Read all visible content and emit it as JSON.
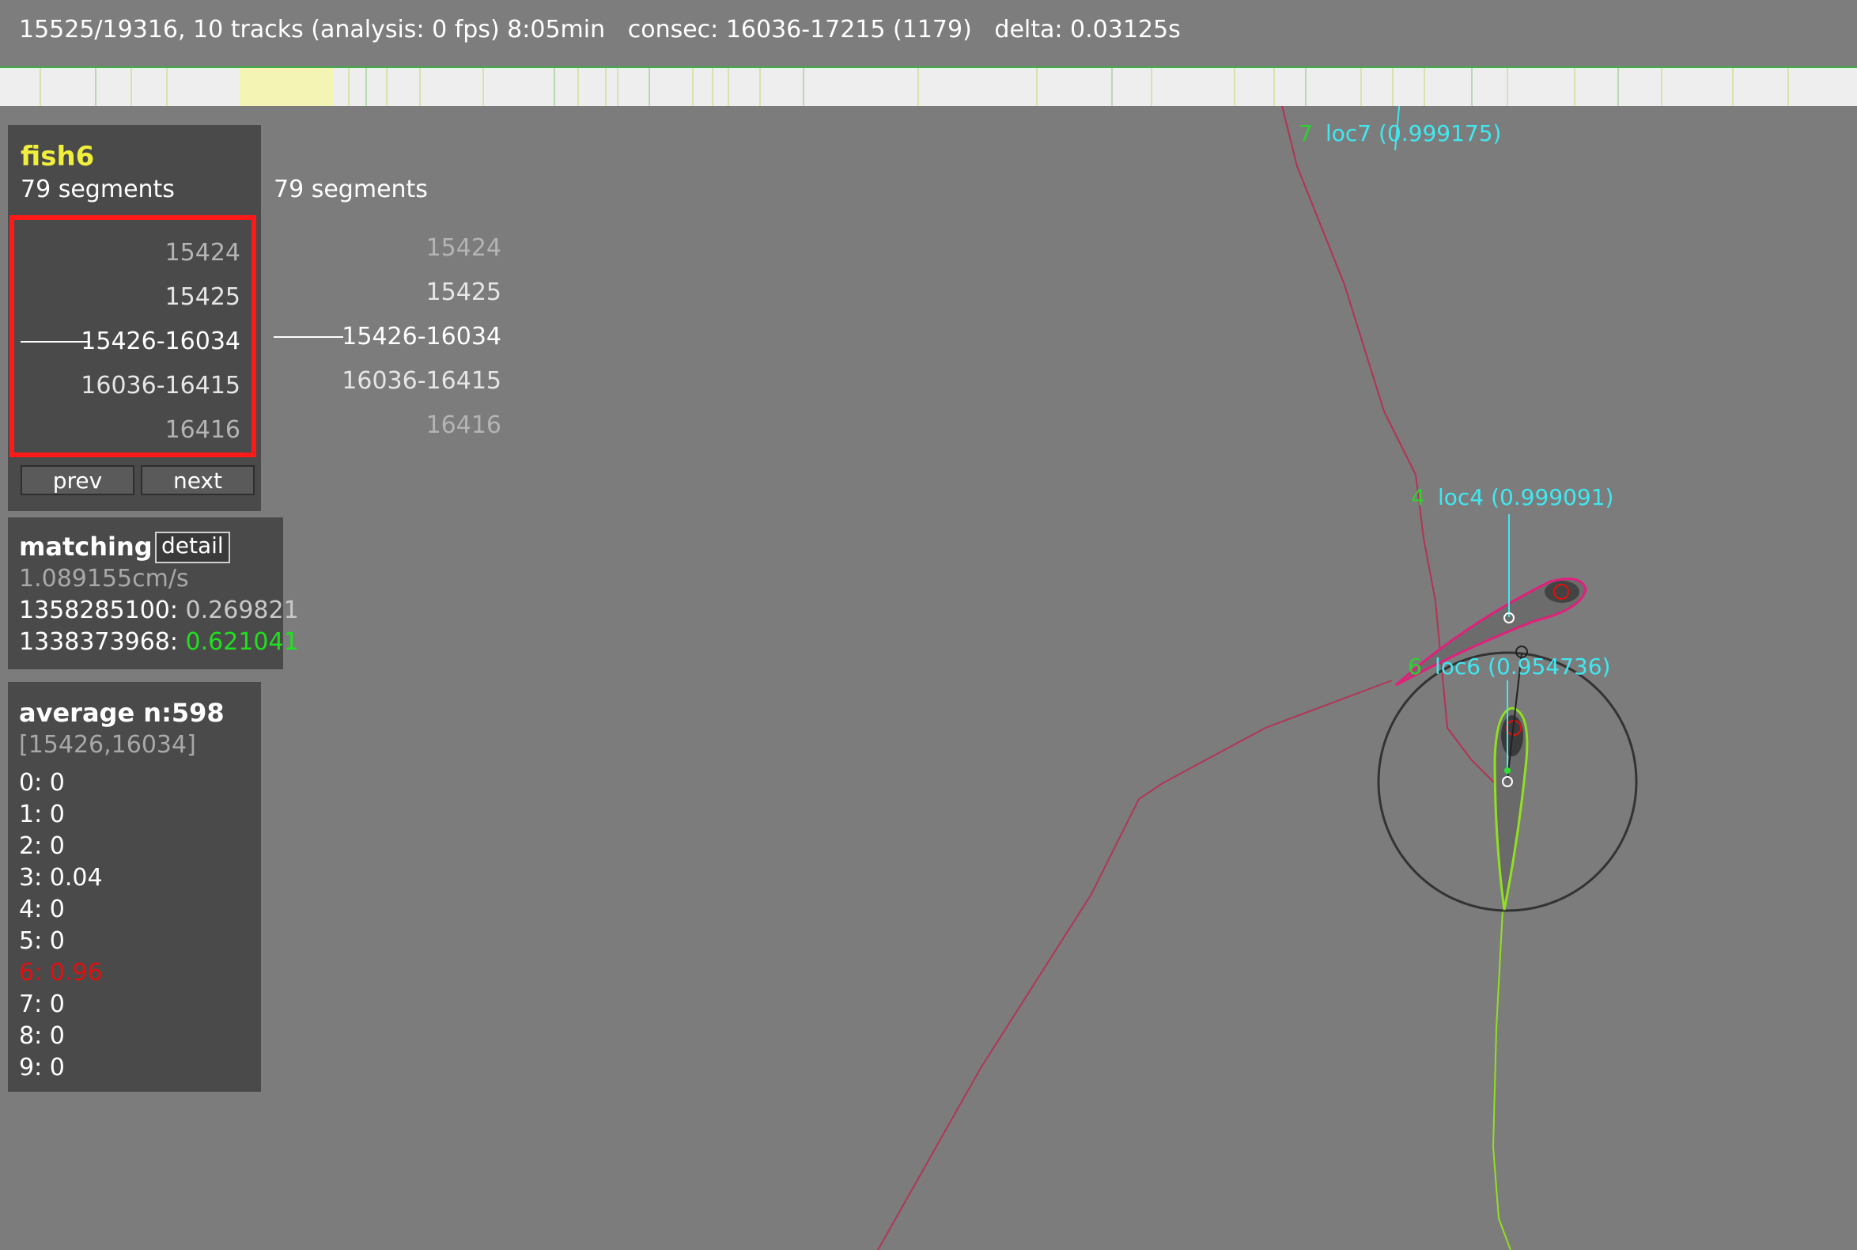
{
  "status": {
    "text": "15525/19316, 10 tracks (analysis: 0 fps) 8:05min   consec: 16036-17215 (1179)   delta: 0.03125s"
  },
  "track_labels": [
    {
      "id": "7",
      "name": "loc7 (0.999175)"
    },
    {
      "id": "4",
      "name": "loc4 (0.999091)"
    },
    {
      "id": "6",
      "name": "loc6 (0.954736)"
    }
  ],
  "fish_panel": {
    "title": "fish6",
    "segments_label": "79 segments",
    "segments_label_right": "79 segments",
    "segments": [
      "15424",
      "15425",
      "15426-16034",
      "16036-16415",
      "16416"
    ],
    "segments_right": [
      "15424",
      "15425",
      "15426-16034",
      "16036-16415",
      "16416"
    ],
    "prev_label": "prev",
    "next_label": "next"
  },
  "matching_panel": {
    "title": "matching",
    "detail_label": "detail",
    "speed": "1.089155cm/s",
    "match1_id": "1358285100:",
    "match1_val": " 0.269821",
    "match2_id": "1338373968:",
    "match2_val": " 0.621041"
  },
  "average_panel": {
    "title": "average n:598",
    "range": "[15426,16034]",
    "entries": [
      "0: 0",
      "1: 0",
      "2: 0",
      "3: 0.04",
      "4: 0",
      "5: 0",
      "6: 0.96",
      "7: 0",
      "8: 0",
      "9: 0"
    ]
  },
  "colors": {
    "fish_title": "#f0f03c",
    "highlight_red": "#e01010",
    "match_green": "#20e020",
    "label_cyan": "#40e8f0",
    "label_green": "#30d030",
    "trail_red": "#c0204a",
    "trail_green": "#90e020"
  }
}
